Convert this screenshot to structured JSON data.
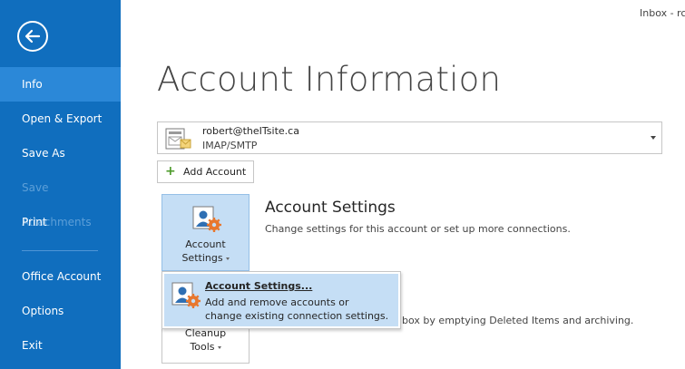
{
  "window": {
    "title_fragment": "Inbox - rc"
  },
  "sidebar": {
    "items": [
      {
        "label": "Info",
        "active": true,
        "disabled": false
      },
      {
        "label": "Open & Export",
        "active": false,
        "disabled": false
      },
      {
        "label": "Save As",
        "active": false,
        "disabled": false
      },
      {
        "label": "Save Attachments",
        "active": false,
        "disabled": true
      },
      {
        "label": "Print",
        "active": false,
        "disabled": false
      },
      {
        "label": "Office Account",
        "active": false,
        "disabled": false
      },
      {
        "label": "Options",
        "active": false,
        "disabled": false
      },
      {
        "label": "Exit",
        "active": false,
        "disabled": false
      }
    ]
  },
  "main": {
    "title": "Account Information",
    "account": {
      "email": "robert@theITsite.ca",
      "type": "IMAP/SMTP"
    },
    "add_account_label": "Add Account",
    "account_settings": {
      "button_line1": "Account",
      "button_line2": "Settings",
      "title": "Account Settings",
      "description": "Change settings for this account or set up more connections."
    },
    "cleanup": {
      "button_line1": "Cleanup",
      "button_line2": "Tools",
      "description_fragment": "lbox by emptying Deleted Items and archiving."
    },
    "dropdown": {
      "item_title": "Account Settings...",
      "item_desc_line1": "Add and remove accounts or",
      "item_desc_line2": "change existing connection settings."
    }
  },
  "colors": {
    "sidebar_bg": "#106ebe",
    "sidebar_active": "#2b88d8",
    "highlight": "#c5def5",
    "add_icon": "#4c9a2a",
    "gear": "#e8772e"
  }
}
